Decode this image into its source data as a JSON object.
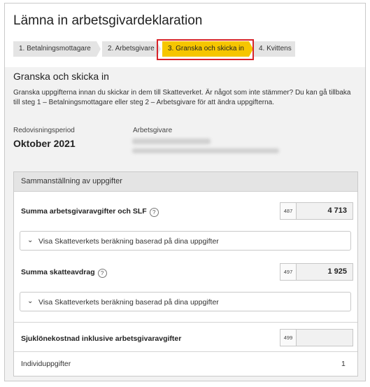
{
  "page": {
    "title": "Lämna in arbetsgivardeklaration"
  },
  "steps": [
    {
      "label": "1. Betalningsmottagare",
      "active": false
    },
    {
      "label": "2. Arbetsgivare",
      "active": false
    },
    {
      "label": "3. Granska och skicka in",
      "active": true
    },
    {
      "label": "4. Kvittens",
      "active": false
    }
  ],
  "section": {
    "heading": "Granska och skicka in",
    "intro": "Granska uppgifterna innan du skickar in dem till Skatteverket. Är något som inte stämmer? Du kan gå tillbaka till steg 1 – Betalningsmottagare eller steg 2 – Arbetsgivare för att ändra uppgifterna."
  },
  "meta": {
    "period_label": "Redovisningsperiod",
    "period_value": "Oktober 2021",
    "employer_label": "Arbetsgivare"
  },
  "summary": {
    "header": "Sammanställning av uppgifter",
    "rows": [
      {
        "title": "Summa arbetsgivaravgifter och SLF",
        "code": "487",
        "amount": "4 713",
        "expander": "Visa Skatteverkets beräkning baserad på dina uppgifter"
      },
      {
        "title": "Summa skatteavdrag",
        "code": "497",
        "amount": "1 925",
        "expander": "Visa Skatteverkets beräkning baserad på dina uppgifter"
      },
      {
        "title": "Sjuklönekostnad inklusive arbetsgivaravgifter",
        "code": "499",
        "amount": ""
      }
    ],
    "individ_label": "Individuppgifter",
    "individ_count": "1"
  },
  "colors": {
    "active_step": "#f6c600",
    "highlight": "#d8232a"
  }
}
